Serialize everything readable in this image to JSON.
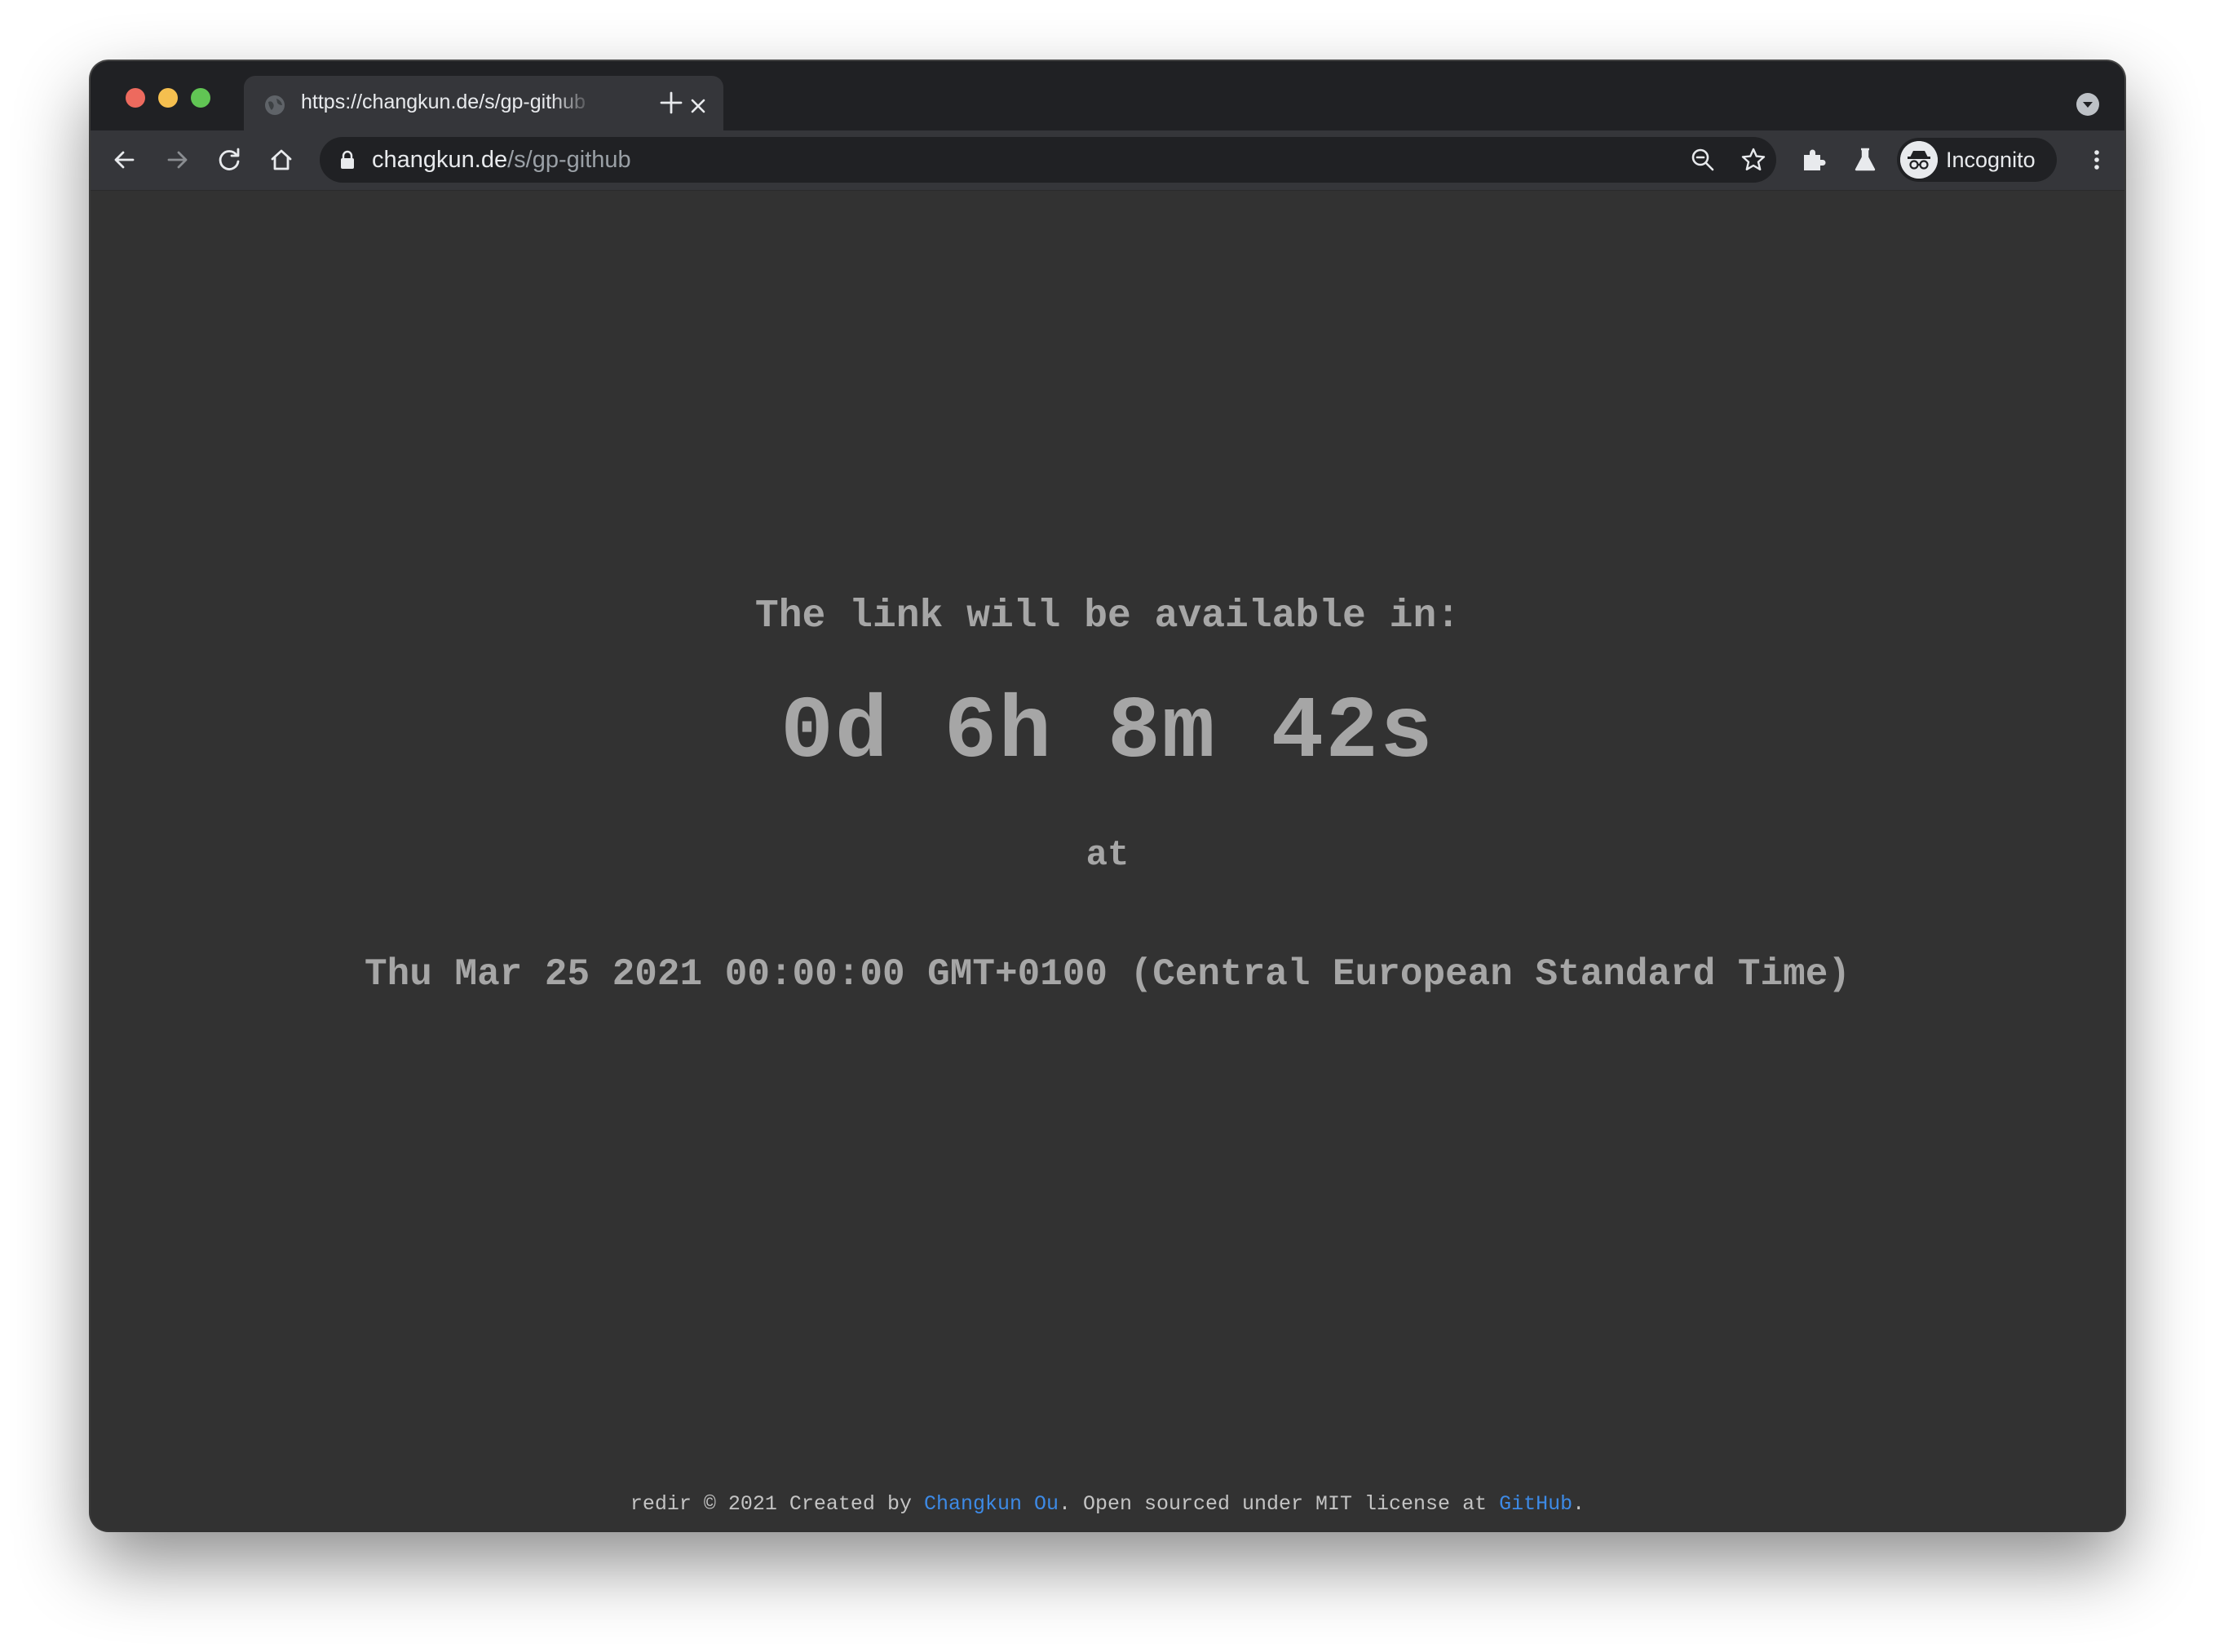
{
  "browser": {
    "tab": {
      "title": "https://changkun.de/s/gp-github",
      "favicon": "globe-icon"
    },
    "toolbar": {
      "url_host": "changkun.de",
      "url_path": "/s/gp-github",
      "profile_label": "Incognito"
    }
  },
  "page": {
    "headline": "The link will be available in:",
    "countdown": "0d 6h 8m 42s",
    "at_label": "at",
    "target_date": "Thu Mar 25 2021 00:00:00 GMT+0100 (Central European Standard Time)",
    "footer": {
      "prefix": "redir © 2021 Created by ",
      "author_link": "Changkun Ou",
      "middle": ". Open sourced under MIT license at ",
      "repo_link": "GitHub",
      "suffix": "."
    }
  },
  "colors": {
    "page_bg": "#323232",
    "text": "#a6a6a6",
    "link": "#3d8ae6",
    "chrome_dark": "#202124",
    "chrome_toolbar": "#35363a"
  }
}
